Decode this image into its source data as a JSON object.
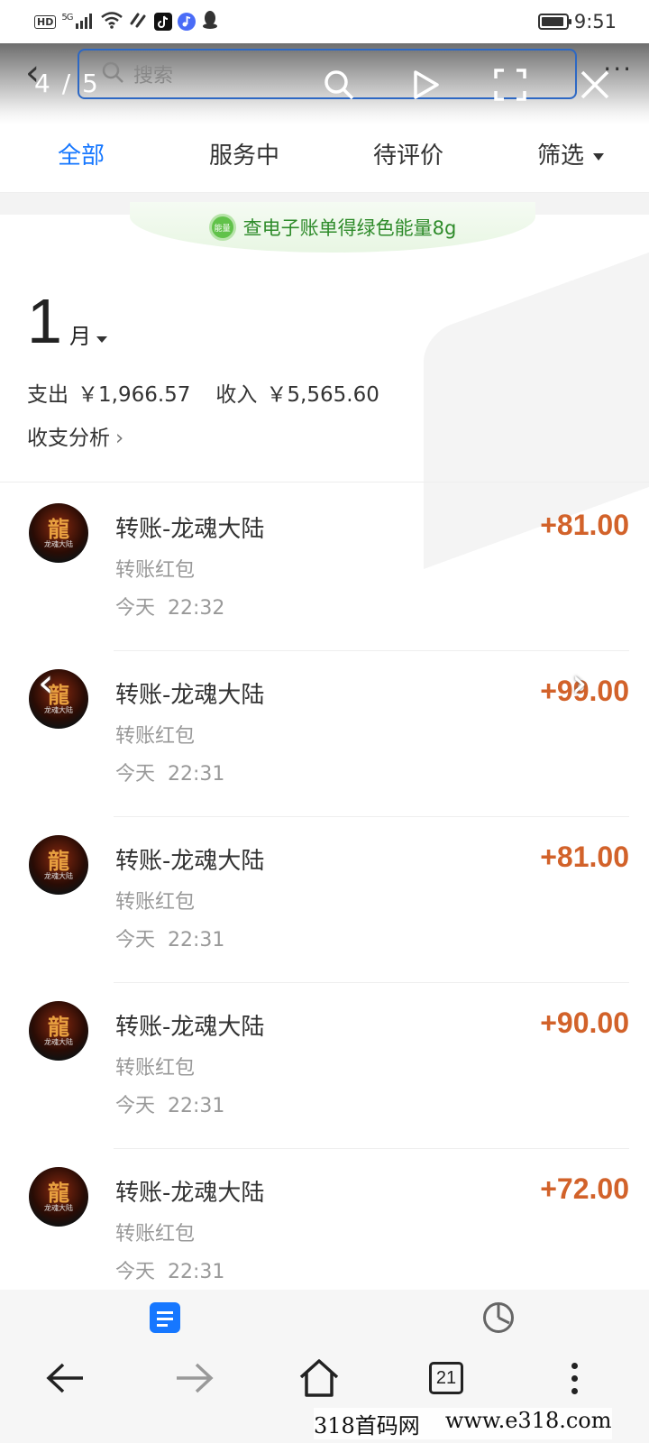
{
  "status_bar": {
    "hd": "HD",
    "network": "5G",
    "time": "9:51",
    "colors": {
      "tiktok": "#111111",
      "music": "#4a6cf7"
    },
    "icons": [
      "hd-icon",
      "signal-icon",
      "wifi-icon",
      "nfc-icon",
      "tiktok-icon",
      "music-icon",
      "qq-icon",
      "battery-icon"
    ]
  },
  "viewer": {
    "page_counter": "4 / 5",
    "search_placeholder": "搜索",
    "icons": [
      "back-chevron-icon",
      "search-icon",
      "play-icon",
      "fullscreen-icon",
      "close-icon",
      "more-icon"
    ]
  },
  "tabs": {
    "all": "全部",
    "in_service": "服务中",
    "pending_review": "待评价",
    "filter": "筛选",
    "active": "all",
    "active_color": "#1677ff"
  },
  "energy_banner": {
    "icon_label": "能量",
    "text": "查电子账单得绿色能量8g"
  },
  "summary": {
    "month_number": "1",
    "month_unit": "月",
    "expense_label": "支出",
    "expense_value": "￥1,966.57",
    "income_label": "收入",
    "income_value": "￥5,565.60",
    "analysis_link": "收支分析",
    "analysis_arrow": "›"
  },
  "avatar": {
    "glyph": "龍",
    "sub": "龙魂大陆"
  },
  "transactions": [
    {
      "title": "转账-龙魂大陆",
      "subtitle": "转账红包",
      "day": "今天",
      "time": "22:32",
      "amount": "+81.00"
    },
    {
      "title": "转账-龙魂大陆",
      "subtitle": "转账红包",
      "day": "今天",
      "time": "22:31",
      "amount": "+99.00"
    },
    {
      "title": "转账-龙魂大陆",
      "subtitle": "转账红包",
      "day": "今天",
      "time": "22:31",
      "amount": "+81.00"
    },
    {
      "title": "转账-龙魂大陆",
      "subtitle": "转账红包",
      "day": "今天",
      "time": "22:31",
      "amount": "+90.00"
    },
    {
      "title": "转账-龙魂大陆",
      "subtitle": "转账红包",
      "day": "今天",
      "time": "22:31",
      "amount": "+72.00"
    }
  ],
  "amount_color": "#d2622a",
  "browser_bar": {
    "tab_count": "21",
    "icons": [
      "back-arrow-icon",
      "forward-arrow-icon",
      "home-icon",
      "tabs-icon",
      "menu-dots-icon"
    ]
  },
  "watermark": {
    "left": "318首码网",
    "right": "www.e318.com"
  }
}
